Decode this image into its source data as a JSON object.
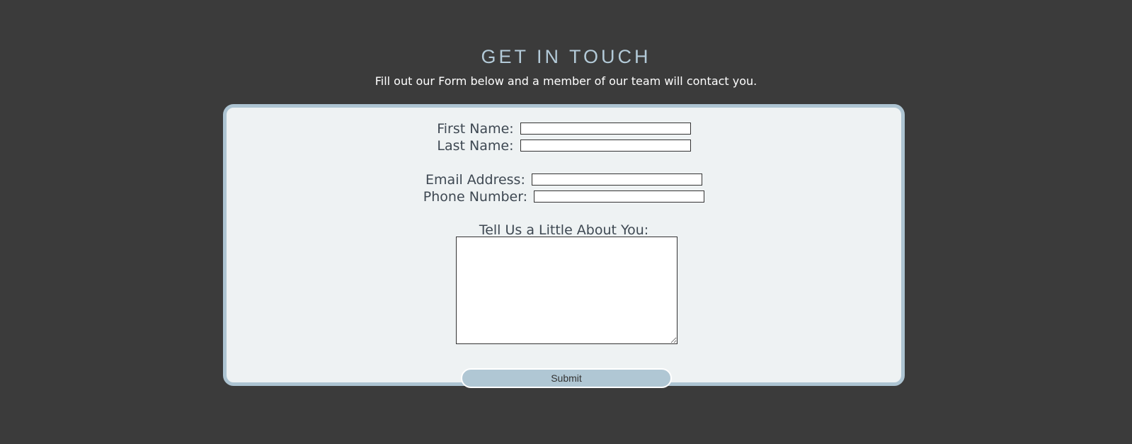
{
  "header": {
    "title": "GET IN TOUCH",
    "subtitle": "Fill out our Form below and a member of our team will contact you."
  },
  "form": {
    "fields": [
      {
        "label": "First Name:",
        "value": ""
      },
      {
        "label": "Last Name:",
        "value": ""
      },
      {
        "label": "Email Address:",
        "value": ""
      },
      {
        "label": "Phone Number:",
        "value": ""
      }
    ],
    "about_label": "Tell Us a Little About You:",
    "about_value": "",
    "submit_label": "Submit"
  },
  "colors": {
    "page_background": "#3b3b3b",
    "heading": "#b3cad8",
    "card_background": "#eef2f3",
    "card_border": "#adc4d2",
    "button_background": "#b0c7d4"
  }
}
